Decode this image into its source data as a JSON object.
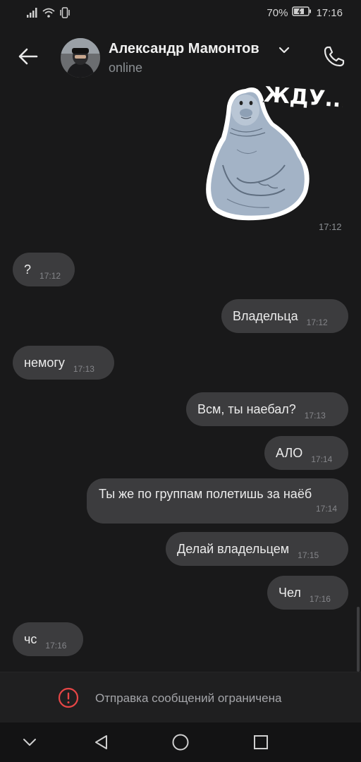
{
  "status_bar": {
    "battery_percent": "70%",
    "time": "17:16",
    "icons": [
      "signal-icon",
      "wifi-icon",
      "vibrate-icon",
      "battery-icon"
    ]
  },
  "header": {
    "contact_name": "Александр Мамонтов",
    "status": "online",
    "icons": [
      "back-arrow-icon",
      "chevron-down-icon",
      "phone-icon"
    ]
  },
  "messages": [
    {
      "type": "sticker",
      "direction": "outgoing",
      "sticker_text": "ЖДУ...",
      "time": "17:12"
    },
    {
      "direction": "incoming",
      "text": "?",
      "time": "17:12"
    },
    {
      "direction": "outgoing",
      "text": "Владельца",
      "time": "17:12"
    },
    {
      "direction": "incoming",
      "text": "немогу",
      "time": "17:13"
    },
    {
      "direction": "outgoing",
      "text": "Всм, ты наебал?",
      "time": "17:13"
    },
    {
      "direction": "outgoing",
      "text": "АЛО",
      "time": "17:14"
    },
    {
      "direction": "outgoing",
      "text": "Ты же по группам полетишь за наёб",
      "time": "17:14"
    },
    {
      "direction": "outgoing",
      "text": "Делай владельцем",
      "time": "17:15"
    },
    {
      "direction": "outgoing",
      "text": "Чел",
      "time": "17:16"
    },
    {
      "direction": "incoming",
      "text": "чс",
      "time": "17:16"
    }
  ],
  "restricted": {
    "text": "Отправка сообщений ограничена",
    "icon": "alert-circle-icon"
  },
  "nav_bar": {
    "icons": [
      "chevron-down-icon",
      "back-triangle-icon",
      "home-circle-icon",
      "recents-square-icon"
    ]
  },
  "colors": {
    "background": "#19191a",
    "bubble": "#3c3c3e",
    "accent_red": "#e64646",
    "muted_text": "#8b8f93"
  }
}
